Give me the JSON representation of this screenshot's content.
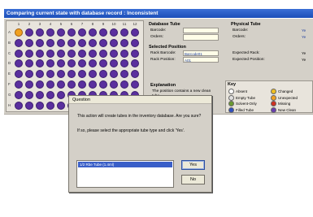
{
  "window": {
    "title": "Comparing current state with database record : Inconsistent"
  },
  "plate": {
    "columns": [
      "1",
      "2",
      "3",
      "4",
      "5",
      "6",
      "7",
      "8",
      "9",
      "10",
      "11",
      "12"
    ],
    "rows": [
      "A",
      "B",
      "C",
      "D",
      "E",
      "F",
      "G",
      "H"
    ],
    "selected_well": "A01"
  },
  "database_tube": {
    "title": "Database Tube",
    "barcode_label": "Barcode:",
    "orders_label": "Orders:",
    "barcode_value": "",
    "orders_value": ""
  },
  "selected_position": {
    "title": "Selected Position",
    "rack_barcode_label": "Rack Barcode:",
    "rack_barcode_value": "Barcode01",
    "rack_position_label": "Rack Position:",
    "rack_position_value": "A01"
  },
  "physical_tube": {
    "title": "Physical Tube",
    "barcode_label": "Barcode:",
    "orders_label": "Orders:",
    "barcode_value": "Ye",
    "orders_value": "Ye"
  },
  "expected": {
    "rack_label": "Expected Rack:",
    "rack_value": "Ye",
    "position_label": "Expected Position:",
    "position_value": "Ye"
  },
  "explanation": {
    "title": "Explanation",
    "text": "The position contains a new clean tube."
  },
  "key": {
    "title": "Key",
    "items": [
      {
        "label": "Absent",
        "color": "#ffffff"
      },
      {
        "label": "Changed",
        "color": "#f0c020"
      },
      {
        "label": "Empty Tube",
        "color": "#e0e0e0"
      },
      {
        "label": "Unexpected",
        "color": "#f0a020"
      },
      {
        "label": "Solvent-Only",
        "color": "#6a9a30"
      },
      {
        "label": "Missing",
        "color": "#d03020"
      },
      {
        "label": "Filled Tube",
        "color": "#3050c0"
      },
      {
        "label": "New Clean",
        "color": "#6a3fb0"
      }
    ]
  },
  "dialog": {
    "title": "Question",
    "message_1": "This action will create tubes in the inventory database. Are you sure?",
    "message_2": "If so, please select the appropriate tube type and click 'Yes'.",
    "list_item": "1/2 Rbe Tube (1.4ml)",
    "yes_label": "Yes",
    "no_label": "No"
  },
  "colors": {
    "well": "#5a2f9e",
    "selected_well": "#f0a020",
    "titlebar": "#1c4fb8"
  }
}
